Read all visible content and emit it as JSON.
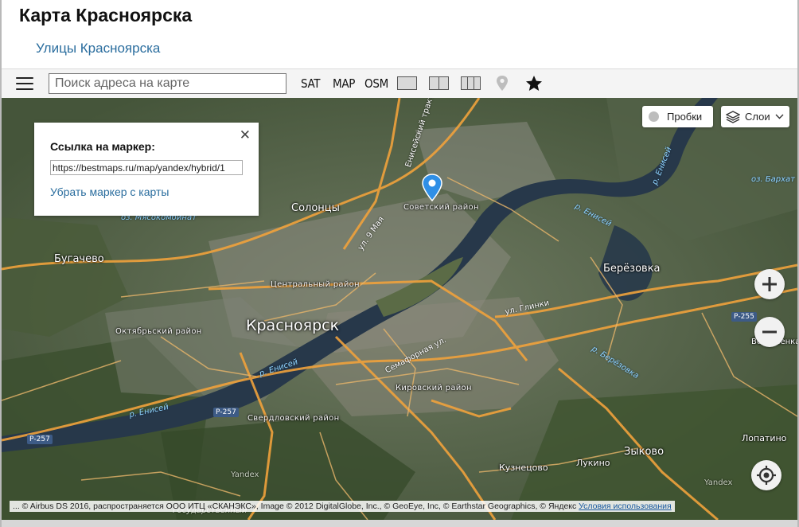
{
  "header": {
    "title": "Карта Красноярска",
    "streets_link": "Улицы Красноярска"
  },
  "toolbar": {
    "search_placeholder": "Поиск адреса на карте",
    "modes": [
      "SAT",
      "MAP",
      "OSM"
    ],
    "layout_icons": [
      "single-pane-icon",
      "two-pane-icon",
      "three-pane-icon"
    ],
    "marker_icon": "map-pin-icon",
    "favorite_icon": "star-icon"
  },
  "popup": {
    "heading": "Ссылка на маркер:",
    "link_value": "https://bestmaps.ru/map/yandex/hybrid/1",
    "remove_link": "Убрать маркер с карты",
    "close_glyph": "✕"
  },
  "map_controls": {
    "traffic": "Пробки",
    "layers": "Слои",
    "zoom_in": "+",
    "zoom_out": "−"
  },
  "map_labels": {
    "city": "Красноярск",
    "places": [
      "Солонцы",
      "Бугачево",
      "Берёзовка",
      "Зыково",
      "Кузнецово",
      "Лукино",
      "Лопатино",
      "Вознесенка",
      "Yandex",
      "Yandex",
      "Государственный"
    ],
    "districts": [
      "Советский район",
      "Центральный район",
      "Октябрьский район",
      "Свердловский район",
      "Кировский район"
    ],
    "water": [
      "оз. Мясокомбинат",
      "р. Енисей",
      "р. Енисей",
      "р. Енисей",
      "р. Енисей",
      "р. Берёзовка",
      "оз. Бархат"
    ],
    "streets": [
      "Енисейский тракт",
      "ул. 9 Мая",
      "Семафорная ул.",
      "ул. Глинки"
    ],
    "road_shields": [
      "Р-257",
      "Р-257",
      "Р-255"
    ]
  },
  "attribution": {
    "text": "... © Airbus DS 2016, распространяется ООО ИТЦ «СКАНЭКС», Image © 2012 DigitalGlobe, Inc., © GeoEye, Inc, © Earthstar Geographics, © Яндекс ",
    "terms_link": "Условия использования"
  },
  "colors": {
    "link": "#2a6d9e",
    "road": "#f0a23c",
    "river": "#27384a",
    "marker": "#2f8fe6"
  }
}
